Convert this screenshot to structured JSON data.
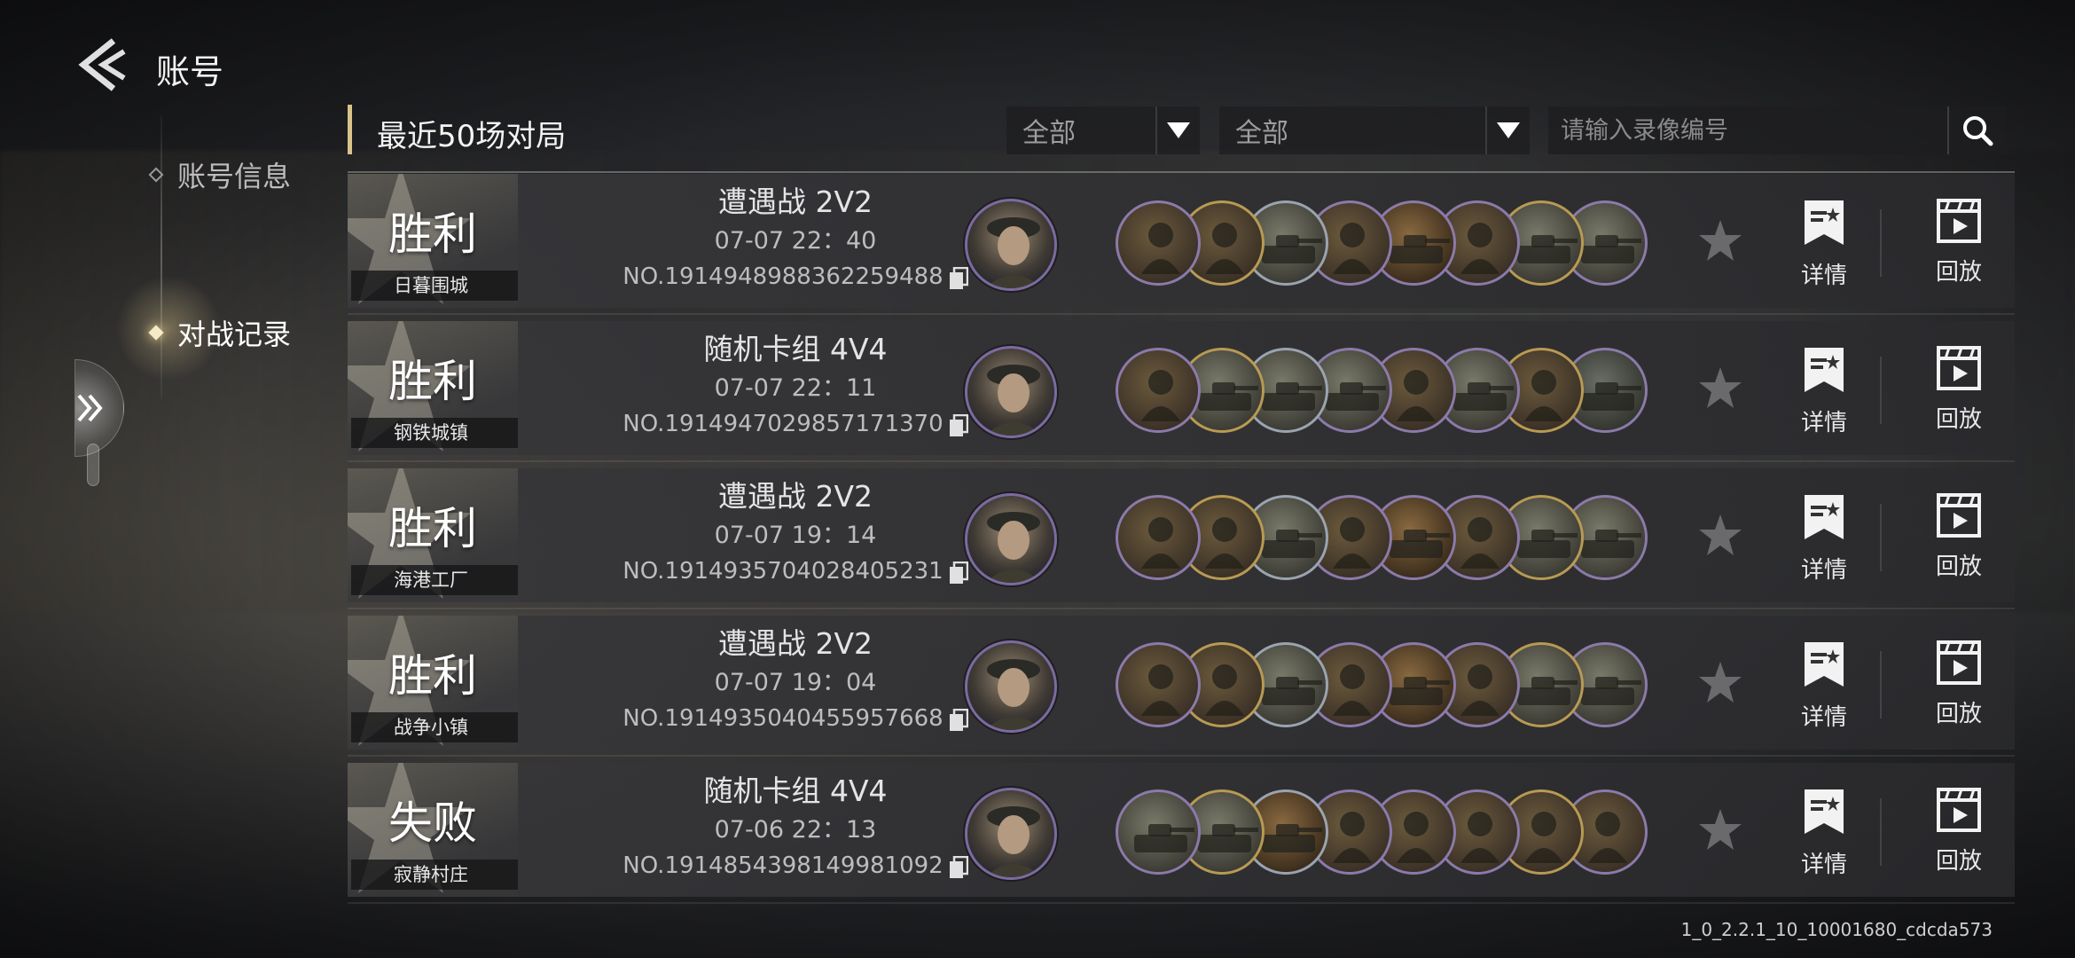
{
  "header": {
    "title": "账号"
  },
  "nav": {
    "items": [
      {
        "label": "账号信息",
        "active": false
      },
      {
        "label": "对战记录",
        "active": true
      }
    ]
  },
  "list": {
    "title": "最近50场对局",
    "filter1": {
      "value": "全部"
    },
    "filter2": {
      "value": "全部"
    },
    "search": {
      "placeholder": "请输入录像编号",
      "value": ""
    }
  },
  "actions": {
    "detail_label": "详情",
    "replay_label": "回放"
  },
  "matches": [
    {
      "result": "胜利",
      "map": "日暮围城",
      "mode": "遭遇战 2V2",
      "time": "07-07  22：40",
      "number": "NO.1914948988362259488",
      "commander_icon": "officer-cap-portrait",
      "units": [
        "infantry-icon",
        "infantry-icon",
        "tank-icon",
        "infantry-icon",
        "artillery-icon",
        "infantry-icon",
        "tank-icon",
        "tank-icon"
      ]
    },
    {
      "result": "胜利",
      "map": "钢铁城镇",
      "mode": "随机卡组 4V4",
      "time": "07-07  22：11",
      "number": "NO.1914947029857171370",
      "commander_icon": "female-officer-portrait",
      "units": [
        "infantry-icon",
        "tank-icon",
        "tank-icon",
        "tank-icon",
        "infantry-icon",
        "tank-icon",
        "infantry-icon",
        "armored-car-icon"
      ]
    },
    {
      "result": "胜利",
      "map": "海港工厂",
      "mode": "遭遇战 2V2",
      "time": "07-07  19：14",
      "number": "NO.1914935704028405231",
      "commander_icon": "officer-cap-portrait",
      "units": [
        "infantry-icon",
        "infantry-icon",
        "tank-icon",
        "infantry-icon",
        "artillery-icon",
        "infantry-icon",
        "tank-icon",
        "tank-icon"
      ]
    },
    {
      "result": "胜利",
      "map": "战争小镇",
      "mode": "遭遇战 2V2",
      "time": "07-07  19：04",
      "number": "NO.1914935040455957668",
      "commander_icon": "officer-cap-portrait",
      "units": [
        "infantry-icon",
        "infantry-icon",
        "tank-icon",
        "infantry-icon",
        "artillery-icon",
        "infantry-icon",
        "tank-icon",
        "tank-icon"
      ]
    },
    {
      "result": "失败",
      "map": "寂静村庄",
      "mode": "随机卡组 4V4",
      "time": "07-06  22：13",
      "number": "NO.1914854398149981092",
      "commander_icon": "goggles-officer-portrait",
      "units": [
        "tank-icon",
        "tank-icon",
        "artillery-icon",
        "infantry-icon",
        "infantry-icon",
        "infantry-icon",
        "infantry-icon",
        "infantry-icon"
      ]
    }
  ],
  "footer": {
    "version": "1_0_2.2.1_10_10001680_cdcda573"
  }
}
